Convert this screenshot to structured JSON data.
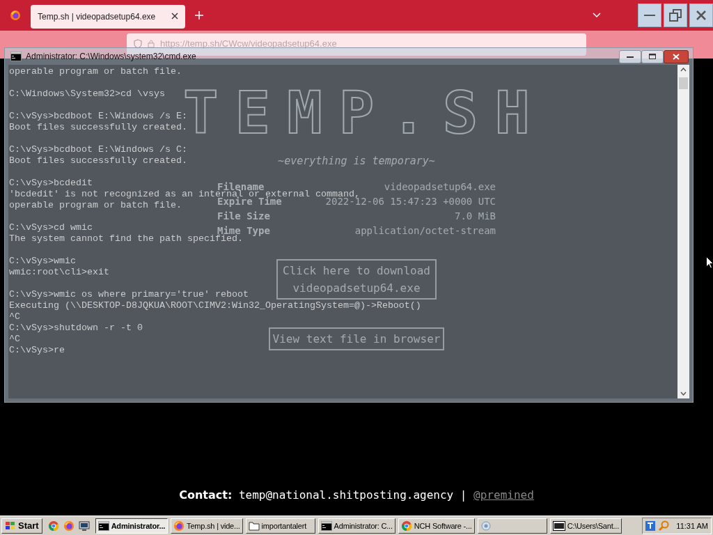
{
  "browser": {
    "tabs": [
      {
        "title": "Temp.sh | videopadsetup64.exe",
        "selected": true
      }
    ],
    "url": "https://temp.sh/CWcw/videopadsetup64.exe"
  },
  "page": {
    "logo": "TEMP.SH",
    "tagline": "~everything is temporary~",
    "details": [
      {
        "label": "Filename",
        "value": "videopadsetup64.exe"
      },
      {
        "label": "Expire Time",
        "value": "2022-12-06 15:47:23 +0000 UTC"
      },
      {
        "label": "File Size",
        "value": "7.0 MiB"
      },
      {
        "label": "Mime Type",
        "value": "application/octet-stream"
      }
    ],
    "download_button": "Click here to download videopadsetup64.exe",
    "view_button": "View text file in browser",
    "contact": {
      "label": "Contact:",
      "email": "temp@national.shitposting.agency",
      "separator": "|",
      "link": "@premined"
    }
  },
  "console": {
    "title": "Administrator: C:\\Windows\\system32\\cmd.exe",
    "blocks": [
      [
        "operable program or batch file."
      ],
      [
        "C:\\Windows\\System32>cd \\vsys"
      ],
      [
        "C:\\vSys>bcdboot E:\\Windows /s E:",
        "Boot files successfully created."
      ],
      [
        "C:\\vSys>bcdboot E:\\Windows /s C:",
        "Boot files successfully created."
      ],
      [
        "C:\\vSys>bcdedit",
        "'bcdedit' is not recognized as an internal or external command,",
        "operable program or batch file."
      ],
      [
        "C:\\vSys>cd wmic",
        "The system cannot find the path specified."
      ],
      [
        "C:\\vSys>wmic",
        "wmic:root\\cli>exit"
      ],
      [
        "C:\\vSys>wmic os where primary='true' reboot",
        "Executing (\\\\DESKTOP-D8JQKUA\\ROOT\\CIMV2:Win32_OperatingSystem=@)->Reboot()",
        "^C",
        "C:\\vSys>shutdown -r -t 0",
        "^C",
        "C:\\vSys>re"
      ]
    ]
  },
  "taskbar": {
    "start": "Start",
    "tasks": [
      {
        "kind": "console",
        "label": "Administrator...",
        "selected": true
      },
      {
        "kind": "firefox",
        "label": "Temp.sh | vide...",
        "selected": false
      },
      {
        "kind": "folder",
        "label": "importantalert",
        "selected": false
      },
      {
        "kind": "console",
        "label": "Administrator: C...",
        "selected": false
      },
      {
        "kind": "chrome",
        "label": "NCH Software -...",
        "selected": false
      },
      {
        "kind": "app",
        "selected": false
      },
      {
        "kind": "archive",
        "label": "C:\\Users\\Sant...",
        "selected": false
      }
    ],
    "clock": "11:31 AM"
  }
}
